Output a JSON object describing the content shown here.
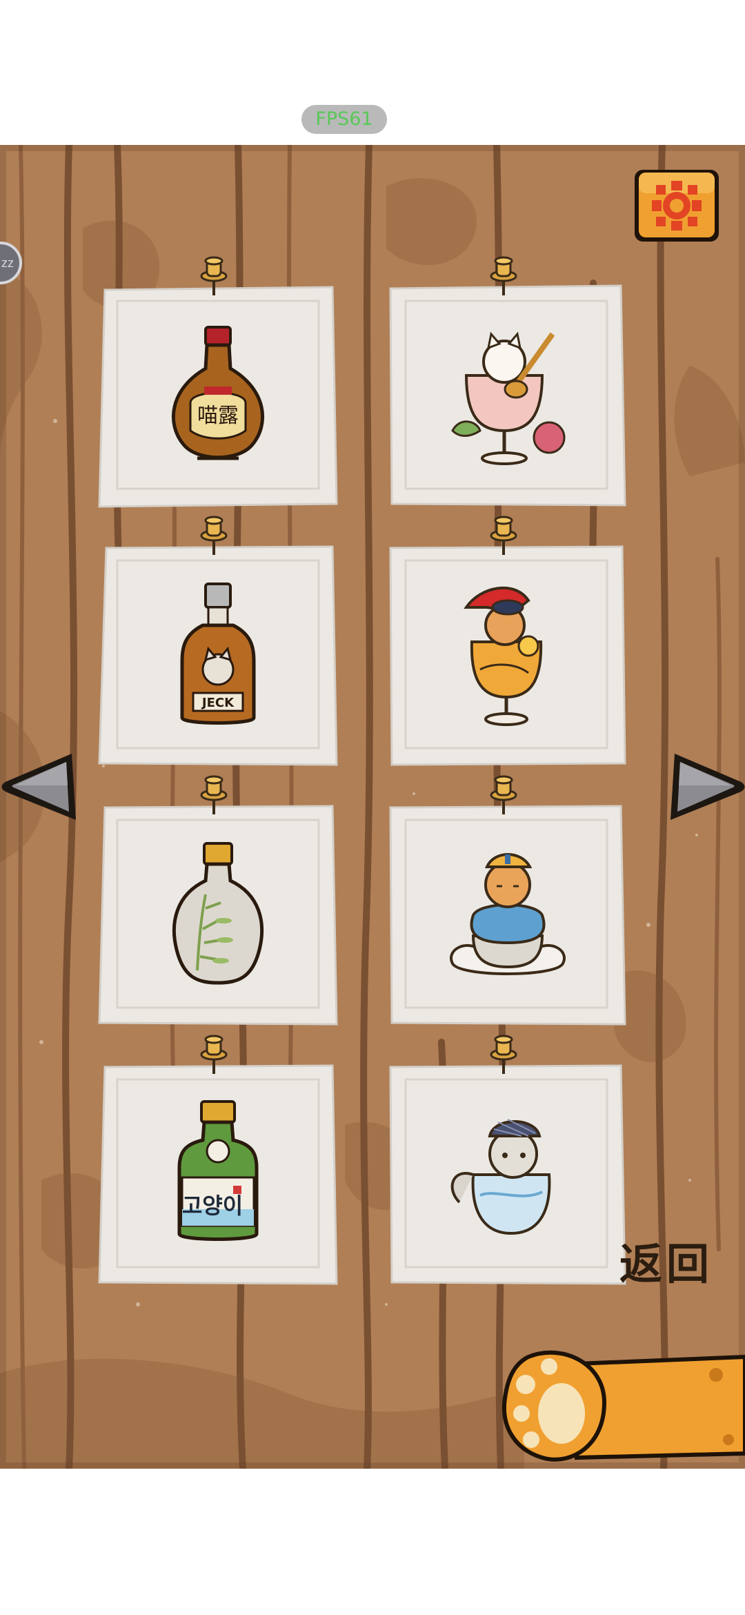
{
  "status": {
    "fps_label": "FPS61"
  },
  "side_badge": {
    "label": "zz"
  },
  "toolbar": {
    "settings_icon": "sun-gear-icon"
  },
  "navigation": {
    "prev_icon": "triangle-left-arrow-icon",
    "next_icon": "triangle-right-arrow-icon",
    "back_label": "返回",
    "back_icon": "cat-paw-icon"
  },
  "collection": {
    "items": [
      {
        "name": "amber-liquor-bottle",
        "bottle_label": "喵露"
      },
      {
        "name": "cat-with-guitar-in-glass"
      },
      {
        "name": "cat-label-whiskey-bottle",
        "bottle_label": "JECK"
      },
      {
        "name": "cat-with-red-hat-in-orange-cocktail"
      },
      {
        "name": "bamboo-porcelain-bottle"
      },
      {
        "name": "cat-in-teacup-on-cloud"
      },
      {
        "name": "green-soju-bottle",
        "bottle_label": "고양이"
      },
      {
        "name": "cat-with-checkered-hat-in-cup"
      }
    ]
  },
  "colors": {
    "wood": "#b07f56",
    "wood_dark": "#8a5d3b",
    "paper": "#ece9e4",
    "accent_orange": "#f0a030",
    "arrow_gray": "#8c8c90"
  }
}
